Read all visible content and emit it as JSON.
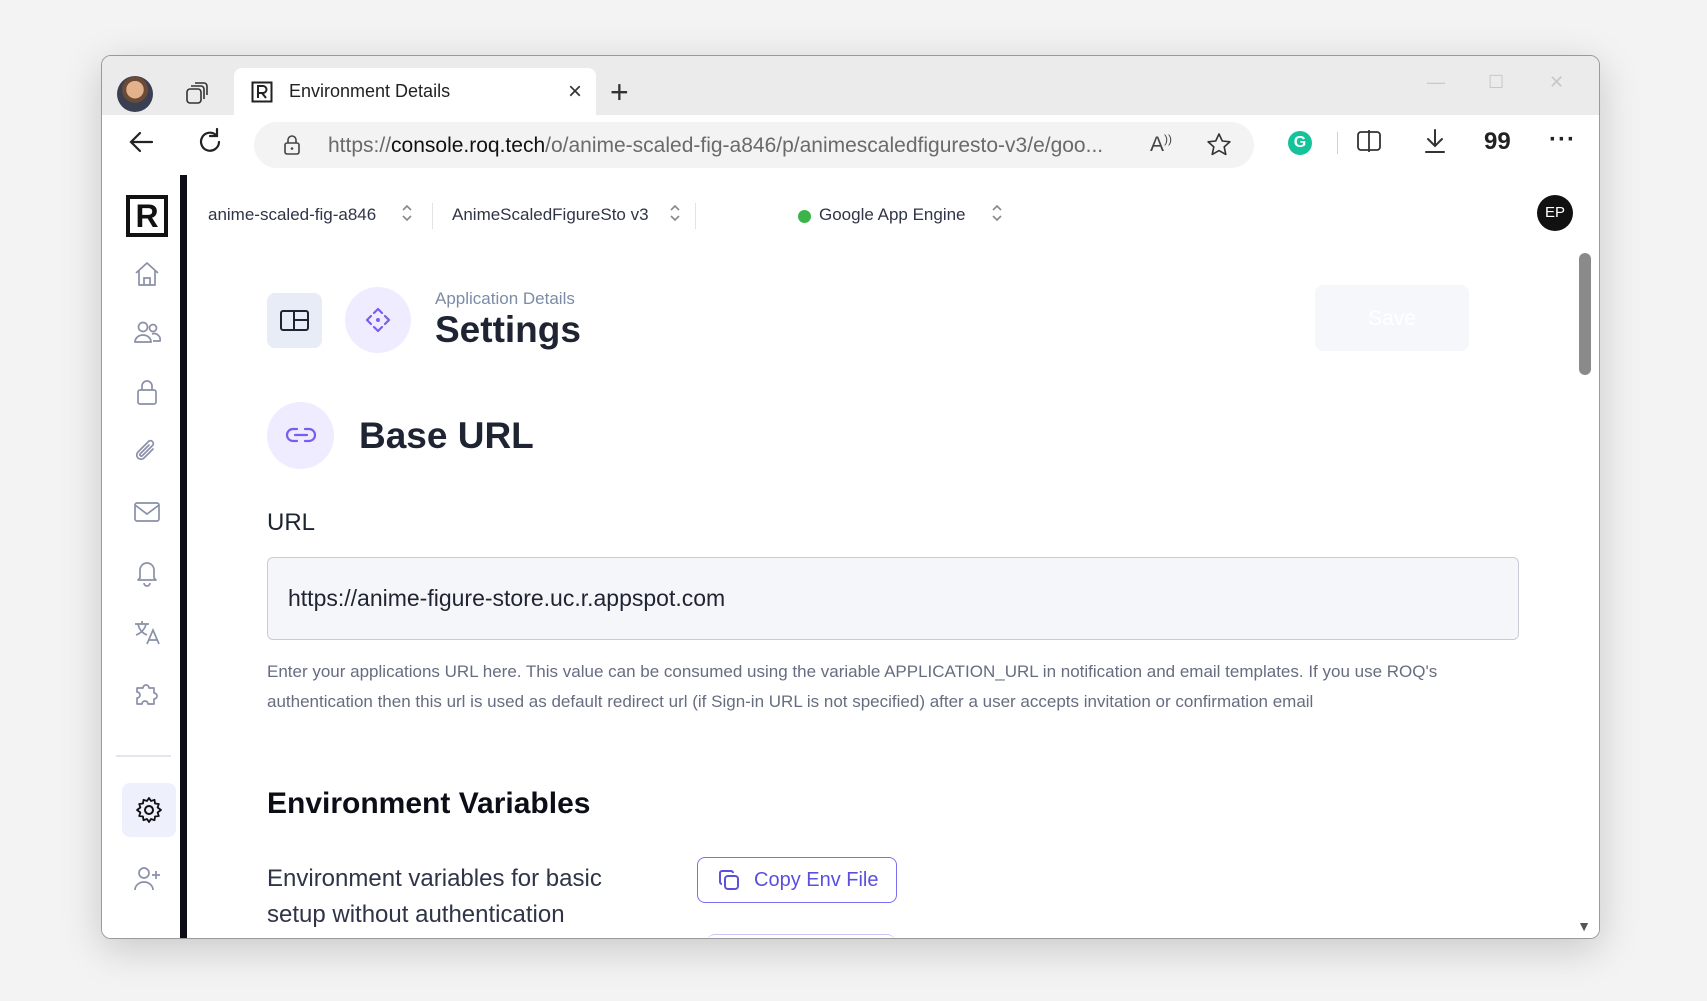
{
  "browser": {
    "tab_title": "Environment Details",
    "tab_close": "×",
    "new_tab": "+",
    "url_prefix": "https://",
    "url_domain": "console.roq.tech",
    "url_rest": "/o/anime-scaled-fig-a846/p/animescaledfiguresto-v3/e/goo...",
    "read_aloud": "Á’",
    "grammarly_letter": "G",
    "quote_icon_label": "99",
    "more_label": "···"
  },
  "topbar": {
    "org": "anime-scaled-fig-a846",
    "project": "AnimeScaledFigureSto v3",
    "environment": "Google App Engine",
    "environment_status_color": "#3bb54a",
    "user_initials": "EP"
  },
  "sidebar": {
    "logo": "R",
    "items": [
      {
        "icon": "home-icon"
      },
      {
        "icon": "users-icon"
      },
      {
        "icon": "lock-icon"
      },
      {
        "icon": "paperclip-icon"
      },
      {
        "icon": "mail-icon"
      },
      {
        "icon": "bell-icon"
      },
      {
        "icon": "translate-icon"
      },
      {
        "icon": "puzzle-icon"
      },
      {
        "icon": "gear-icon",
        "active": true
      },
      {
        "icon": "add-user-icon"
      }
    ]
  },
  "header": {
    "subtitle": "Application Details",
    "title": "Settings",
    "save_label": "Save"
  },
  "base_url": {
    "section_title": "Base URL",
    "field_label": "URL",
    "value": "https://anime-figure-store.uc.r.appspot.com",
    "help": "Enter your applications URL here. This value can be consumed using the variable APPLICATION_URL in notification and email templates. If you use ROQ's authentication then this url is used as default redirect url (if Sign-in URL is not specified) after a user accepts invitation or confirmation email"
  },
  "env_vars": {
    "title": "Environment Variables",
    "description": "Environment variables for basic setup without authentication",
    "copy_label": "Copy Env File"
  },
  "colors": {
    "accent": "#5b4fe0",
    "sidebar_rail": "#0d0d15"
  }
}
